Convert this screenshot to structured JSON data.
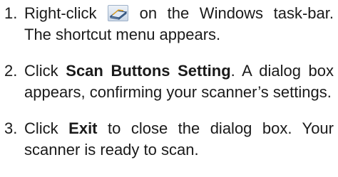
{
  "icon": {
    "name": "scanner-tray-icon"
  },
  "steps": [
    {
      "number": "1.",
      "text_before_icon": "Right-click",
      "text_after_icon": "on the Windows task-bar. The shortcut menu appears."
    },
    {
      "number": "2.",
      "text_before": "Click",
      "bold": "Scan Buttons Setting",
      "text_after": ". A dialog box appears, confirming your scanner’s settings."
    },
    {
      "number": "3.",
      "text_before": "Click",
      "bold": "Exit",
      "text_after": "to close the dialog box. Your scanner is ready to scan."
    }
  ]
}
